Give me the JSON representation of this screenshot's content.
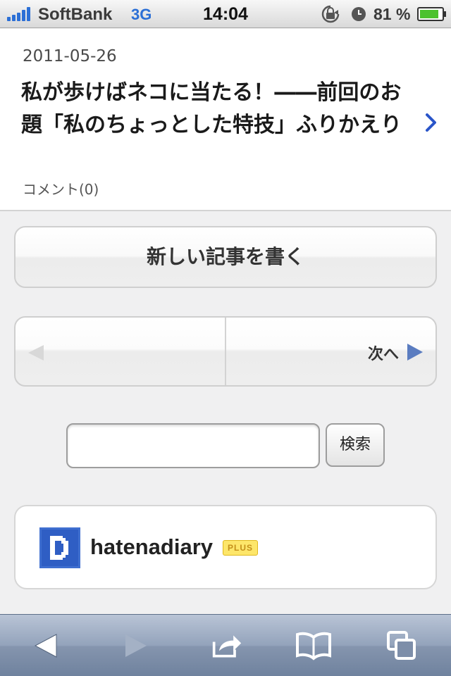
{
  "status_bar": {
    "carrier": "SoftBank",
    "network": "3G",
    "time": "14:04",
    "battery_percent": "81 %"
  },
  "article": {
    "date": "2011-05-26",
    "title": "私が歩けばネコに当たる！――前回のお題「私のちょっとした特技」ふりかえり",
    "comments": "コメント(0)"
  },
  "new_post_label": "新しい記事を書く",
  "pager": {
    "next_label": "次へ"
  },
  "search": {
    "value": "",
    "button_label": "検索"
  },
  "logo": {
    "name": "hatenadiary",
    "badge": "PLUS"
  },
  "colors": {
    "accent_blue": "#2b6fd6",
    "pager_arrow": "#5a7cc0",
    "logo_blue": "#3f6fd0"
  },
  "toolbar_icons": [
    "back-icon",
    "forward-icon",
    "share-icon",
    "bookmarks-icon",
    "tabs-icon"
  ]
}
